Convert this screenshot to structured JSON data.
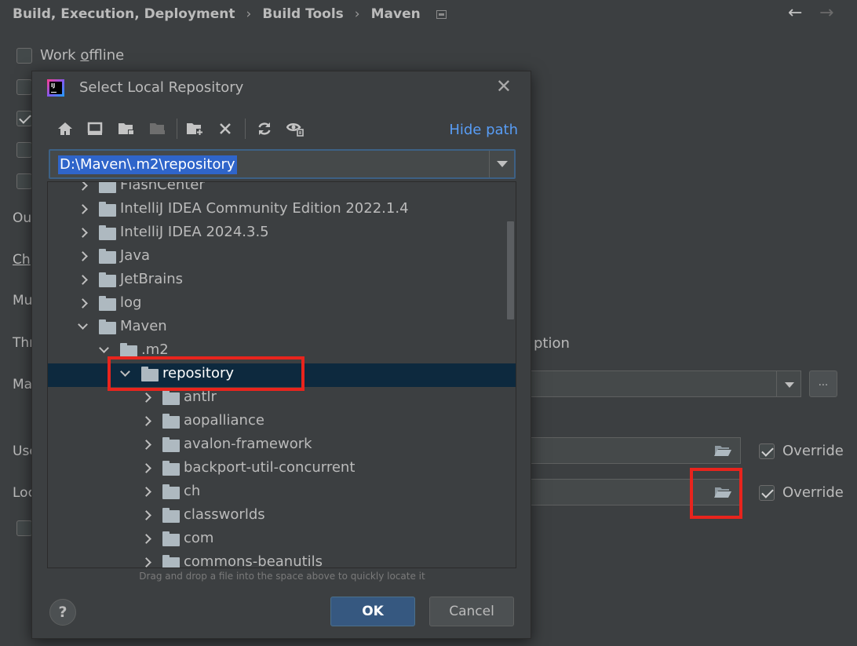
{
  "breadcrumb": {
    "items": [
      "Build, Execution, Deployment",
      "Build Tools",
      "Maven"
    ],
    "separator": "›"
  },
  "nav": {
    "back_icon": "←",
    "forward_icon": "→"
  },
  "settings": {
    "work_offline_label": "Work offline",
    "side_labels": [
      "Ou",
      "Ch",
      "Mu",
      "Thr",
      "Ma",
      "Use",
      "Loc"
    ],
    "option_suffix": "ption",
    "dots_label": "...",
    "override_label": "Override",
    "override_user_settings_checked": true,
    "override_local_repo_checked": true
  },
  "dialog": {
    "title": "Select Local Repository",
    "close_icon": "✕",
    "hide_path_label": "Hide path",
    "path_value": "D:\\Maven\\.m2\\repository",
    "toolbar_icons": [
      "home-icon",
      "desktop-icon",
      "project-folder-icon",
      "module-folder-icon",
      "new-folder-icon",
      "delete-icon",
      "refresh-icon",
      "show-hidden-icon"
    ],
    "tree": [
      {
        "label": "FlashCenter",
        "level": 1,
        "expanded": false
      },
      {
        "label": "IntelliJ IDEA Community Edition 2022.1.4",
        "level": 1,
        "expanded": false
      },
      {
        "label": "IntelliJ IDEA 2024.3.5",
        "level": 1,
        "expanded": false
      },
      {
        "label": "Java",
        "level": 1,
        "expanded": false
      },
      {
        "label": "JetBrains",
        "level": 1,
        "expanded": false
      },
      {
        "label": "log",
        "level": 1,
        "expanded": false
      },
      {
        "label": "Maven",
        "level": 1,
        "expanded": true
      },
      {
        "label": ".m2",
        "level": 2,
        "expanded": true
      },
      {
        "label": "repository",
        "level": 3,
        "expanded": true,
        "selected": true
      },
      {
        "label": "antlr",
        "level": 4,
        "expanded": false
      },
      {
        "label": "aopalliance",
        "level": 4,
        "expanded": false
      },
      {
        "label": "avalon-framework",
        "level": 4,
        "expanded": false
      },
      {
        "label": "backport-util-concurrent",
        "level": 4,
        "expanded": false
      },
      {
        "label": "ch",
        "level": 4,
        "expanded": false
      },
      {
        "label": "classworlds",
        "level": 4,
        "expanded": false
      },
      {
        "label": "com",
        "level": 4,
        "expanded": false
      },
      {
        "label": "commons-beanutils",
        "level": 4,
        "expanded": false
      }
    ],
    "drag_hint": "Drag and drop a file into the space above to quickly locate it",
    "help_label": "?",
    "ok_label": "OK",
    "cancel_label": "Cancel"
  },
  "colors": {
    "background": "#3c3f41",
    "selection": "#0d293e",
    "link": "#589df6",
    "highlight": "#e8241d",
    "primary_button": "#365880"
  }
}
